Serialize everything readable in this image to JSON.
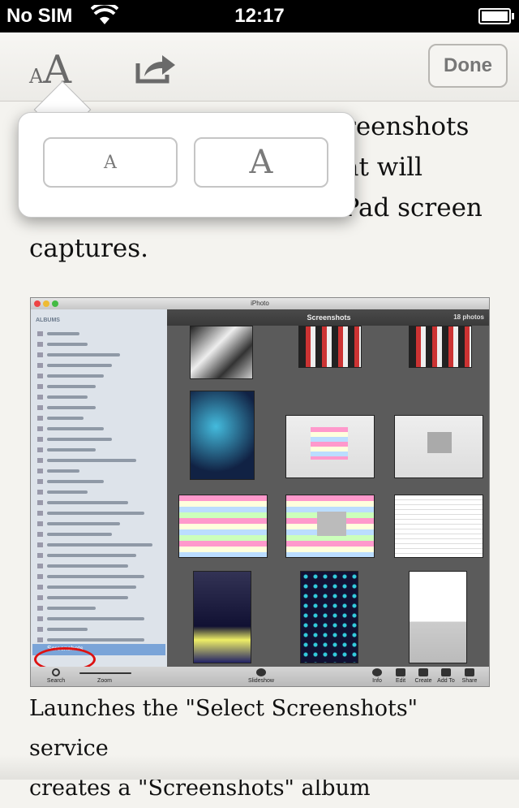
{
  "status": {
    "carrier": "No SIM",
    "time": "12:17"
  },
  "toolbar": {
    "font_small": "A",
    "font_big": "A",
    "done_label": "Done"
  },
  "popover": {
    "small_label": "A",
    "large_label": "A"
  },
  "body": {
    "lines": [
      "reenshots",
      "at will",
      "contains an iPhone and iPad screen",
      "captures."
    ]
  },
  "screenshot": {
    "window_title": "iPhoto",
    "sidebar_header": "ALBUMS",
    "main_title": "Screenshots",
    "photo_count": "18 photos",
    "selected_album": "Screenshots",
    "tools_left": [
      "Search",
      "Zoom"
    ],
    "tool_center": "Slideshow",
    "tools_right": [
      "Info",
      "Edit",
      "Create",
      "Add To",
      "Share"
    ]
  },
  "caption": [
    "Launches the \"Select Screenshots\" service",
    "creates a \"Screenshots\" album"
  ],
  "colors": {
    "accent_selection": "#7aa4d8",
    "highlight_ring": "#dd1111"
  }
}
